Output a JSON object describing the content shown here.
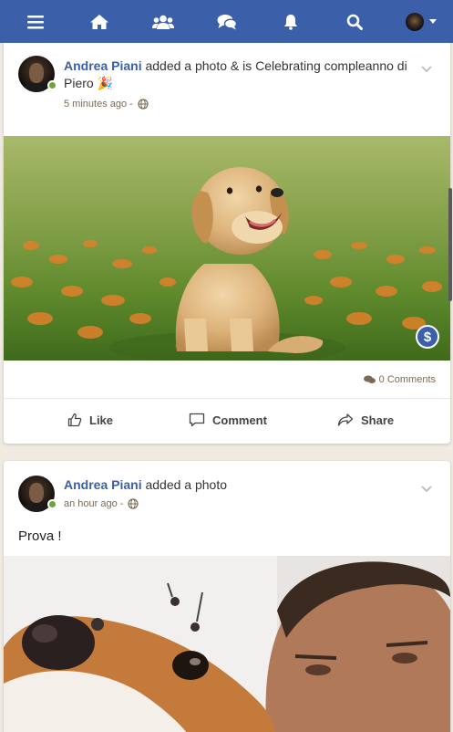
{
  "nav": {
    "items": [
      "menu-icon",
      "home-icon",
      "friends-icon",
      "messages-icon",
      "notifications-icon",
      "search-icon",
      "profile-menu"
    ],
    "color": "#3b5fa8"
  },
  "posts": [
    {
      "author": "Andrea Piani",
      "action": "added a photo & is Celebrating compleanno di Piero 🎉",
      "time": "5 minutes ago -",
      "comments": "0 Comments",
      "actions": {
        "like": "Like",
        "comment": "Comment",
        "share": "Share"
      }
    },
    {
      "author": "Andrea Piani",
      "action": "added a photo",
      "time": "an hour ago -",
      "text": "Prova !"
    }
  ]
}
